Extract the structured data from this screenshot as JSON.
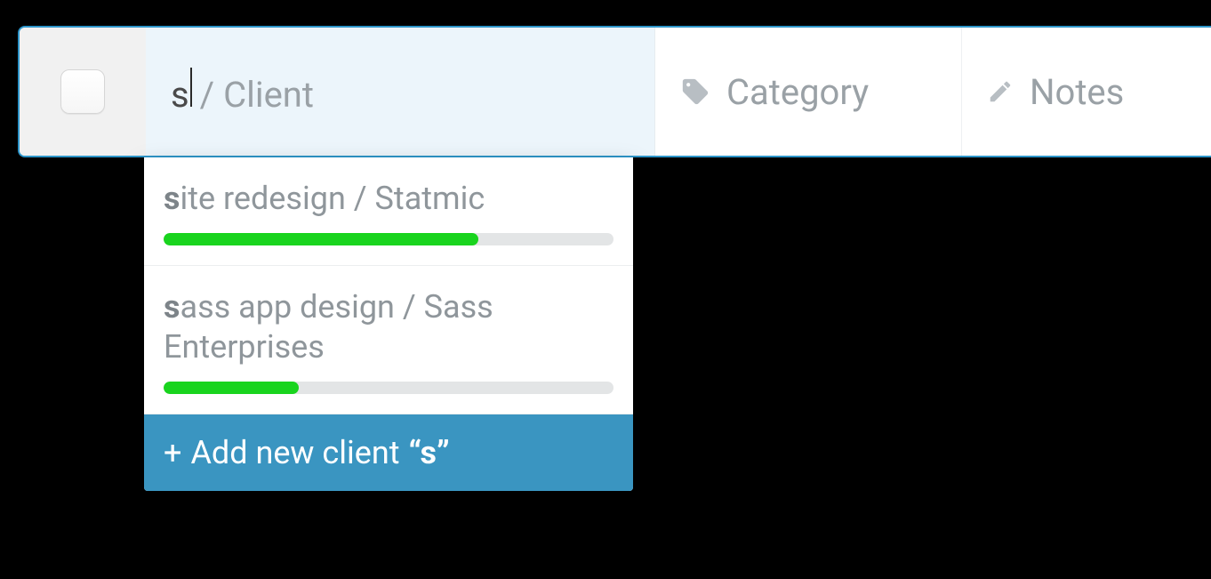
{
  "row": {
    "client": {
      "typed": "s",
      "placeholder_rest": "/ Client"
    },
    "category": {
      "label": "Category"
    },
    "notes": {
      "label": "Notes"
    }
  },
  "dropdown": {
    "items": [
      {
        "bold": "s",
        "rest": "ite redesign / Statmic",
        "progress_pct": 70
      },
      {
        "bold": "s",
        "rest": "ass app design / Sass Enterprises",
        "progress_pct": 30
      }
    ],
    "add": {
      "prefix": "+",
      "label": "Add new client",
      "quoted": "“s”"
    }
  },
  "colors": {
    "accent": "#2d95c9",
    "progress": "#19d41e"
  }
}
